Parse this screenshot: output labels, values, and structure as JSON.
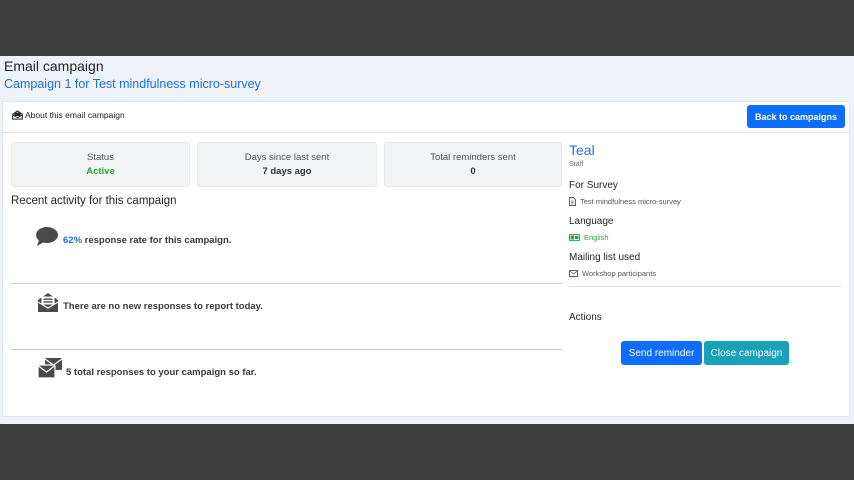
{
  "page": {
    "title": "Email campaign",
    "subtitle": "Campaign 1 for Test mindfulness micro-survey"
  },
  "header": {
    "about_label": "About this email campaign",
    "back_button": "Back to campaigns"
  },
  "stats": [
    {
      "label": "Status",
      "value": "Active"
    },
    {
      "label": "Days since last sent",
      "value": "7 days ago"
    },
    {
      "label": "Total reminders sent",
      "value": "0"
    }
  ],
  "activity": {
    "heading": "Recent activity for this campaign",
    "items": [
      {
        "highlight": "62%",
        "text": " response rate for this campaign.",
        "icon": "speech-bubble-icon"
      },
      {
        "highlight": "",
        "text": "There are no new responses to report today.",
        "icon": "open-envelope-icon"
      },
      {
        "highlight": "",
        "text": "5 total responses to your campaign so far.",
        "icon": "envelopes-icon"
      }
    ]
  },
  "sidebar": {
    "color_name": "Teal",
    "role": "Staff",
    "survey_label": "For Survey",
    "survey_value": "Test mindfulness micro-survey",
    "language_label": "Language",
    "language_value": "English",
    "mailing_label": "Mailing list used",
    "mailing_value": "Workshop participants",
    "actions_label": "Actions",
    "send_reminder": "Send reminder",
    "close_campaign": "Close campaign"
  },
  "colors": {
    "primary": "#0d6efd",
    "link": "#1f72d8",
    "success": "#28a745",
    "teal": "#17a2b8",
    "backdrop": "#3d3d3d"
  }
}
